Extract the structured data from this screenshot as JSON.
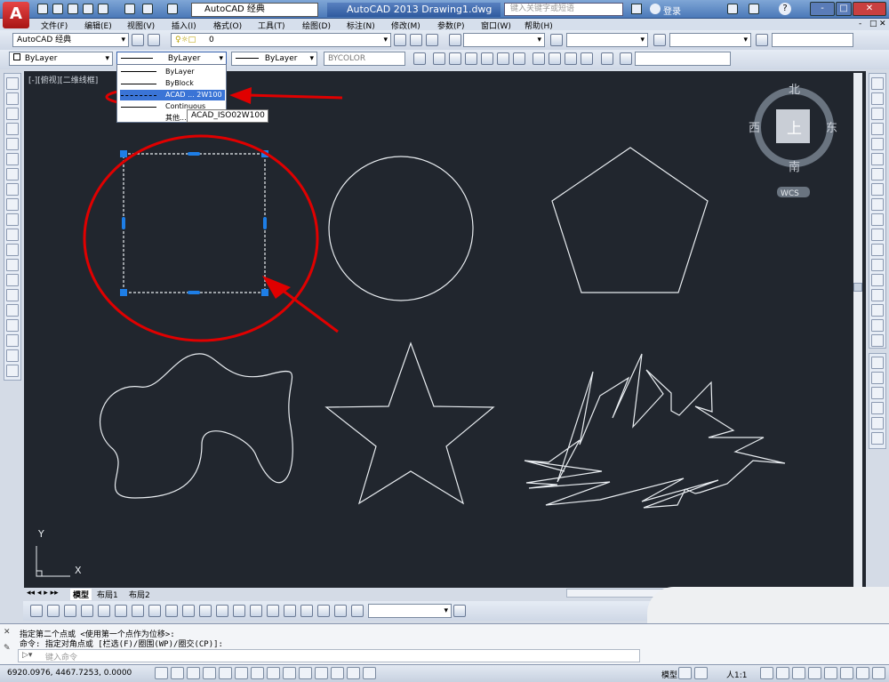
{
  "title": {
    "workspace": "AutoCAD 经典",
    "app_title": "AutoCAD 2013   Drawing1.dwg",
    "search_placeholder": "键入关键字或短语",
    "login": "登录",
    "minimize": "-",
    "restore": "□",
    "close": "✕"
  },
  "menu": [
    "文件(F)",
    "编辑(E)",
    "视图(V)",
    "插入(I)",
    "格式(O)",
    "工具(T)",
    "绘图(D)",
    "标注(N)",
    "修改(M)",
    "参数(P)",
    "窗口(W)",
    "帮助(H)"
  ],
  "toolbar": {
    "workspace_select": "AutoCAD 经典",
    "layer_select": "0",
    "color_select": "ByLayer",
    "linetype_select": "ByLayer",
    "lineweight_select": "ByLayer",
    "plotstyle_select": "BYCOLOR"
  },
  "linetype_popup": {
    "items": [
      "ByLayer",
      "ByBlock",
      "ACAD ... 2W100",
      "Continuous",
      "其他..."
    ],
    "tooltip": "ACAD_ISO02W100"
  },
  "viewport": {
    "label": "[-][俯视][二维线框]",
    "compass": {
      "north": "北",
      "south": "南",
      "west": "西",
      "east": "东",
      "top": "上",
      "wcs": "WCS"
    },
    "ucs": {
      "x": "X",
      "y": "Y"
    }
  },
  "layout_tabs": [
    "模型",
    "布局1",
    "布局2"
  ],
  "command": {
    "line1": "指定第二个点或 <使用第一个点作为位移>:",
    "line2": "命令: 指定对角点或 [栏选(F)/圈围(WP)/圈交(CP)]:",
    "input_placeholder": "键入命令"
  },
  "status": {
    "coords": "6920.0976,  4467.7253,  0.0000",
    "model": "模型",
    "scale": "人1:1"
  },
  "colors": {
    "canvas": "#21262e",
    "annotation": "#e00000",
    "grip": "#1e7ee6"
  }
}
